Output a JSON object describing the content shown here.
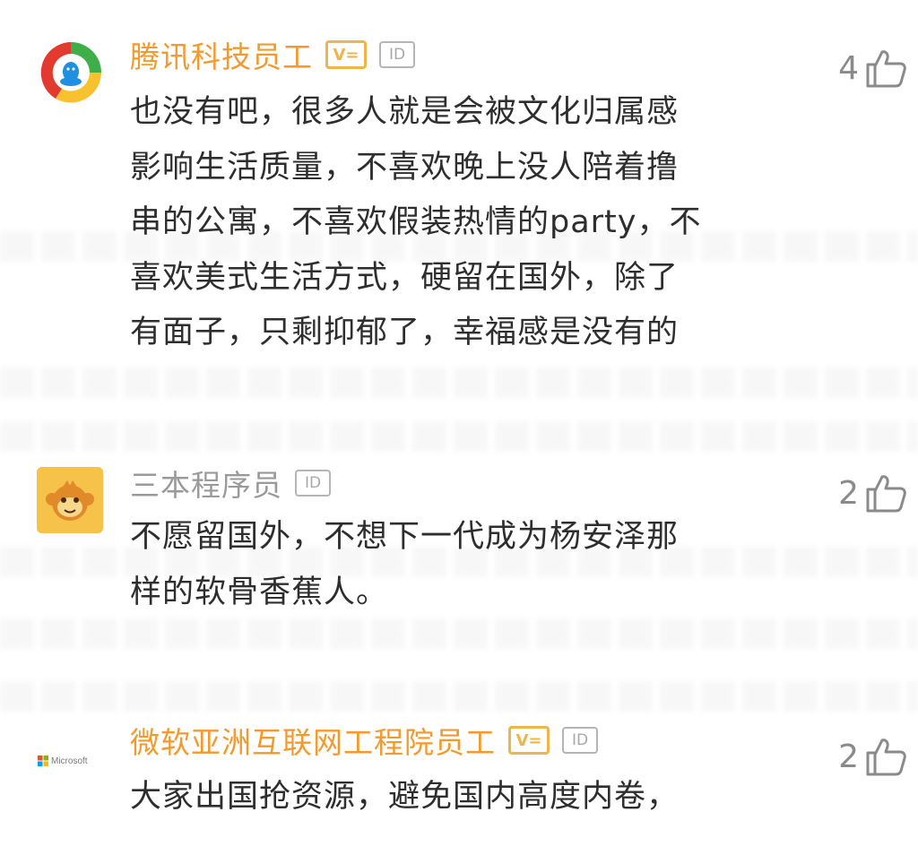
{
  "comments": [
    {
      "username": "腾讯科技员工",
      "badge_v": "V=",
      "badge_id": "ID",
      "likes": "4",
      "text": "也没有吧，很多人就是会被文化归属感\n影响生活质量，不喜欢晚上没人陪着撸\n串的公寓，不喜欢假装热情的party，不\n喜欢美式生活方式，硬留在国外，除了\n有面子，只剩抑郁了，幸福感是没有的",
      "avatar_icon": "tencent-logo-icon"
    },
    {
      "username": "三本程序员",
      "badge_id": "ID",
      "likes": "2",
      "text": "不愿留国外，不想下一代成为杨安泽那\n样的软骨香蕉人。",
      "avatar_icon": "monkey-avatar-icon"
    },
    {
      "username": "微软亚洲互联网工程院员工",
      "badge_v": "V=",
      "badge_id": "ID",
      "likes": "2",
      "text": "大家出国抢资源，避免国内高度内卷，",
      "avatar_text": "Microsoft",
      "avatar_icon": "microsoft-logo-icon"
    }
  ],
  "colors": {
    "vip_name": "#f29a2e",
    "plain_name": "#9a9a9a",
    "body": "#2e2e2e",
    "like": "#8a8a8a"
  }
}
